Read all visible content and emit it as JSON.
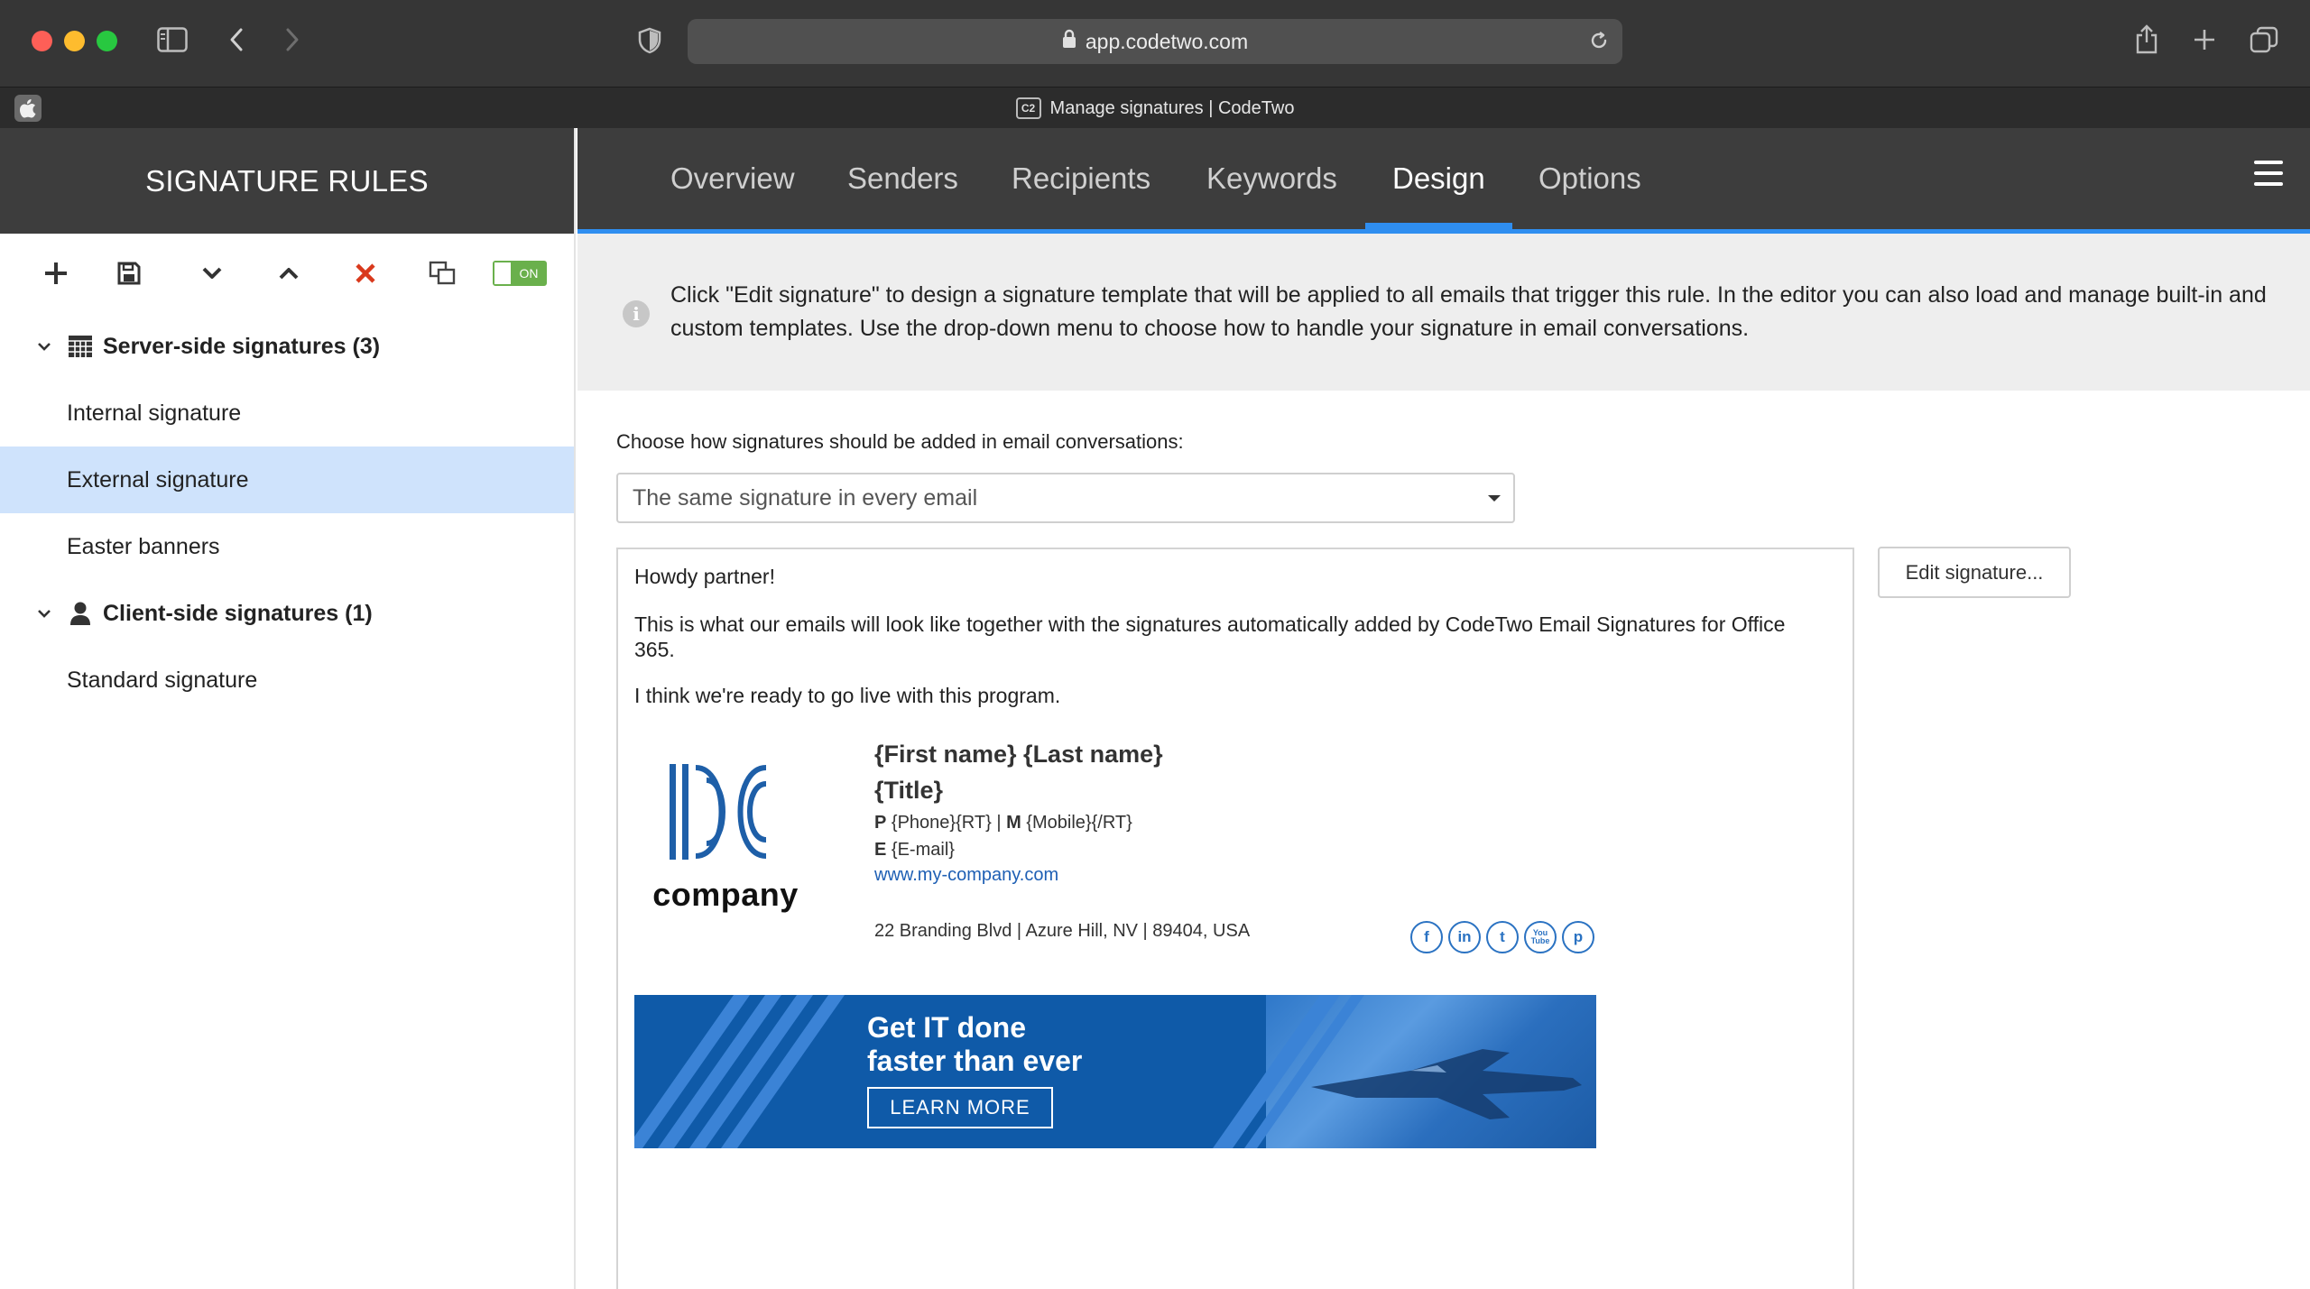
{
  "browser": {
    "url": "app.codetwo.com",
    "tab_title": "Manage signatures | CodeTwo",
    "favicon_text": "C2"
  },
  "sidebar": {
    "title": "SIGNATURE RULES",
    "toggle_label": "ON",
    "groups": [
      {
        "label": "Server-side signatures (3)",
        "icon": "server-grid-icon",
        "rules": [
          "Internal signature",
          "External signature",
          "Easter banners"
        ]
      },
      {
        "label": "Client-side signatures (1)",
        "icon": "person-icon",
        "rules": [
          "Standard signature"
        ]
      }
    ],
    "selected_rule": "External signature"
  },
  "tabs": [
    "Overview",
    "Senders",
    "Recipients",
    "Keywords",
    "Design",
    "Options"
  ],
  "active_tab": "Design",
  "info_text": "Click \"Edit signature\" to design a signature template that will be applied to all emails that trigger this rule. In the editor you can also load and manage built-in and custom templates. Use the drop-down menu to choose how to handle your signature in email conversations.",
  "conversation": {
    "label": "Choose how signatures should be added in email conversations:",
    "selected": "The same signature in every email"
  },
  "edit_button": "Edit signature...",
  "preview": {
    "greeting": "Howdy partner!",
    "body1": "This is what our emails will look like together with the signatures automatically added by CodeTwo Email Signatures for Office 365.",
    "body2": "I think we're ready to go live with this program.",
    "logo_word": "company",
    "name": "{First name} {Last name}",
    "title": "{Title}",
    "phone_label_p": "P",
    "phone_value": "{Phone}{RT}",
    "separator": "|",
    "phone_label_m": "M",
    "mobile_value": "{Mobile}{/RT}",
    "email_label": "E",
    "email_value": "{E-mail}",
    "website": "www.my-company.com",
    "address": "22 Branding Blvd | Azure Hill, NV | 89404, USA",
    "socials": [
      "f",
      "in",
      "t",
      "You Tube",
      "p"
    ],
    "banner_line1": "Get IT done",
    "banner_line2": "faster than ever",
    "banner_button": "LEARN MORE"
  },
  "colors": {
    "accent": "#2f8ef0",
    "header_bg": "#3d3d3d",
    "selected_row": "#cfe3fc",
    "toggle_green": "#6ab04c",
    "delete_red": "#d9391c",
    "link_blue": "#1e5fb4",
    "banner_blue": "#0f5aa8"
  }
}
